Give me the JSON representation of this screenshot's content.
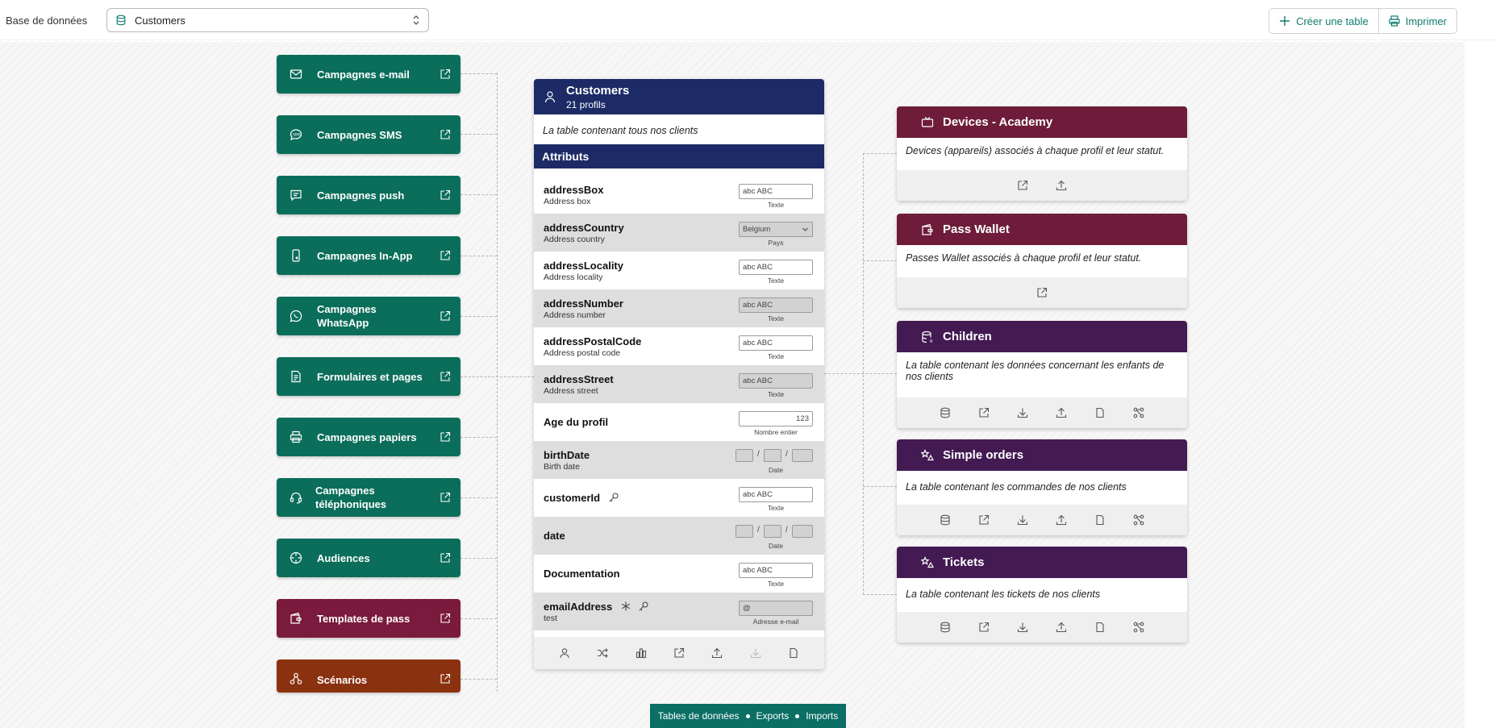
{
  "header": {
    "db_label": "Base de données",
    "db_select_value": "Customers",
    "create_table_label": "Créer une table",
    "print_label": "Imprimer"
  },
  "channels": [
    {
      "label": "Campagnes e-mail",
      "icon": "mail-icon"
    },
    {
      "label": "Campagnes SMS",
      "icon": "sms-icon"
    },
    {
      "label": "Campagnes push",
      "icon": "push-icon"
    },
    {
      "label": "Campagnes In-App",
      "icon": "mobile-icon"
    },
    {
      "label": "Campagnes WhatsApp",
      "icon": "whatsapp-icon"
    },
    {
      "label": "Formulaires et pages",
      "icon": "document-icon"
    },
    {
      "label": "Campagnes papiers",
      "icon": "printer-icon"
    },
    {
      "label": "Campagnes téléphoniques",
      "icon": "headset-icon"
    },
    {
      "label": "Audiences",
      "icon": "target-icon"
    },
    {
      "label": "Templates de pass",
      "icon": "wallet-icon"
    },
    {
      "label": "Scénarios",
      "icon": "workflow-icon"
    }
  ],
  "table": {
    "title": "Customers",
    "subtitle": "21 profils",
    "description": "La table contenant tous nos clients",
    "attributes_title": "Attributs",
    "rows": [
      {
        "name": "addressBox",
        "sub": "Address box",
        "value": "abc ABC",
        "caption": "Texte"
      },
      {
        "name": "addressCountry",
        "sub": "Address country",
        "value": "Belgium",
        "caption": "Pays"
      },
      {
        "name": "addressLocality",
        "sub": "Address locality",
        "value": "abc ABC",
        "caption": "Texte"
      },
      {
        "name": "addressNumber",
        "sub": "Address number",
        "value": "abc ABC",
        "caption": "Texte"
      },
      {
        "name": "addressPostalCode",
        "sub": "Address postal code",
        "value": "abc ABC",
        "caption": "Texte"
      },
      {
        "name": "addressStreet",
        "sub": "Address street",
        "value": "abc ABC",
        "caption": "Texte"
      },
      {
        "name": "Age du profil",
        "sub": "",
        "value": "123",
        "caption": "Nombre entier"
      },
      {
        "name": "birthDate",
        "sub": "Birth date",
        "value": "",
        "caption": "Date"
      },
      {
        "name": "customerId",
        "sub": "",
        "value": "abc ABC",
        "caption": "Texte"
      },
      {
        "name": "date",
        "sub": "",
        "value": "",
        "caption": "Date"
      },
      {
        "name": "Documentation",
        "sub": "",
        "value": "abc ABC",
        "caption": "Texte"
      },
      {
        "name": "emailAddress",
        "sub": "test",
        "value": "@",
        "caption": "Adresse e-mail"
      }
    ]
  },
  "related": [
    {
      "title": "Devices - Academy",
      "description": "Devices (appareils) associés à chaque profil et leur statut."
    },
    {
      "title": "Pass Wallet",
      "description": "Passes Wallet associés à chaque profil et leur statut."
    },
    {
      "title": "Children",
      "description": "La table contenant les données concernant les enfants de nos clients"
    },
    {
      "title": "Simple orders",
      "description": "La table contenant les commandes de nos clients"
    },
    {
      "title": "Tickets",
      "description": "La table contenant les tickets de nos clients"
    }
  ],
  "legend": {
    "item1": "Tables de données",
    "item2": "Exports",
    "item3": "Imports"
  },
  "colors": {
    "channel_green": "#0b6e5a",
    "channel_wine": "#7a1a3c",
    "channel_rust": "#8a3210",
    "table_navy": "#1c2b66",
    "related_maroon": "#6e1c3a",
    "related_purple": "#431a52",
    "accent_teal": "#0f7b6f"
  }
}
